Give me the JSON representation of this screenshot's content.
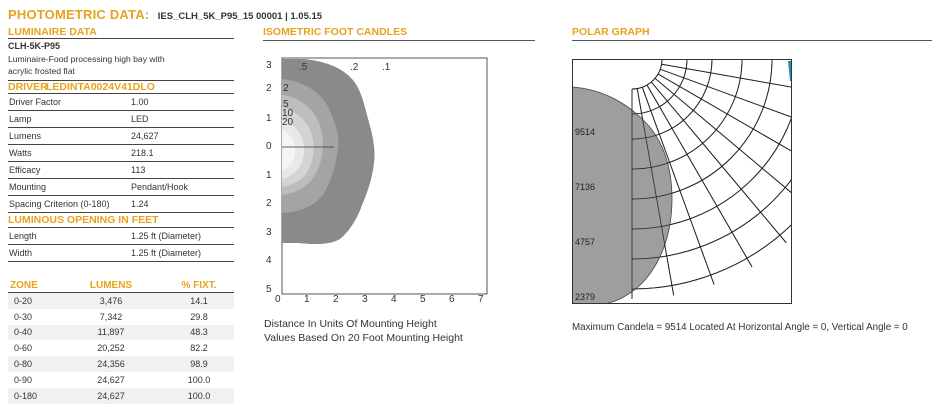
{
  "header": {
    "title": "PHOTOMETRIC DATA:",
    "subtitle": "IES_CLH_5K_P95_15 00001 | 1.05.15"
  },
  "luminaire": {
    "section_title": "LUMINAIRE DATA",
    "model": "CLH-5K-P95",
    "description_line1": "Luminaire-Food processing high bay with",
    "description_line2": "acrylic frosted flat"
  },
  "driver": {
    "label": "DRIVER",
    "value": "LEDINTA0024V41DLO",
    "rows": [
      {
        "k": "Driver Factor",
        "v": "1.00"
      },
      {
        "k": "Lamp",
        "v": "LED"
      },
      {
        "k": "Lumens",
        "v": "24,627"
      },
      {
        "k": "Watts",
        "v": "218.1"
      },
      {
        "k": "Efficacy",
        "v": "113"
      },
      {
        "k": "Mounting",
        "v": "Pendant/Hook"
      },
      {
        "k": "Spacing Criterion (0-180)",
        "v": "1.24"
      }
    ]
  },
  "opening": {
    "section_title": "LUMINOUS OPENING IN FEET",
    "rows": [
      {
        "k": "Length",
        "v": "1.25 ft (Diameter)"
      },
      {
        "k": "Width",
        "v": "1.25 ft (Diameter)"
      }
    ]
  },
  "zones": {
    "headers": [
      "ZONE",
      "LUMENS",
      "% FIXT."
    ],
    "rows": [
      {
        "zone": "0-20",
        "lumens": "3,476",
        "pct": "14.1"
      },
      {
        "zone": "0-30",
        "lumens": "7,342",
        "pct": "29.8"
      },
      {
        "zone": "0-40",
        "lumens": "11,897",
        "pct": "48.3"
      },
      {
        "zone": "0-60",
        "lumens": "20,252",
        "pct": "82.2"
      },
      {
        "zone": "0-80",
        "lumens": "24,356",
        "pct": "98.9"
      },
      {
        "zone": "0-90",
        "lumens": "24,627",
        "pct": "100.0"
      },
      {
        "zone": "0-180",
        "lumens": "24,627",
        "pct": "100.0"
      }
    ]
  },
  "isometric": {
    "section_title": "ISOMETRIC FOOT CANDLES",
    "y_ticks": [
      "3",
      "2",
      "1",
      "0",
      "1",
      "2",
      "3",
      "4",
      "5"
    ],
    "x_ticks": [
      "0",
      "1",
      "2",
      "3",
      "4",
      "5",
      "6",
      "7"
    ],
    "contour_labels": [
      ".5",
      ".2",
      ".1",
      "2",
      "5",
      "10",
      "20"
    ],
    "caption_line1": "Distance In Units Of Mounting Height",
    "caption_line2": "Values Based On 20 Foot Mounting Height",
    "colors": {
      "outer": "#8a8a8a",
      "inner": "#f4f4f4"
    }
  },
  "polar": {
    "section_title": "POLAR GRAPH",
    "candela_labels": [
      "9514",
      "7136",
      "4757",
      "2379"
    ],
    "caption": "Maximum Candela = 9514   Located At Horizontal Angle = 0, Vertical Angle = 0",
    "colors": {
      "fill": "#9e9e9e",
      "accent": "#1e8fb3"
    }
  },
  "accent_color": "#e8a21c"
}
